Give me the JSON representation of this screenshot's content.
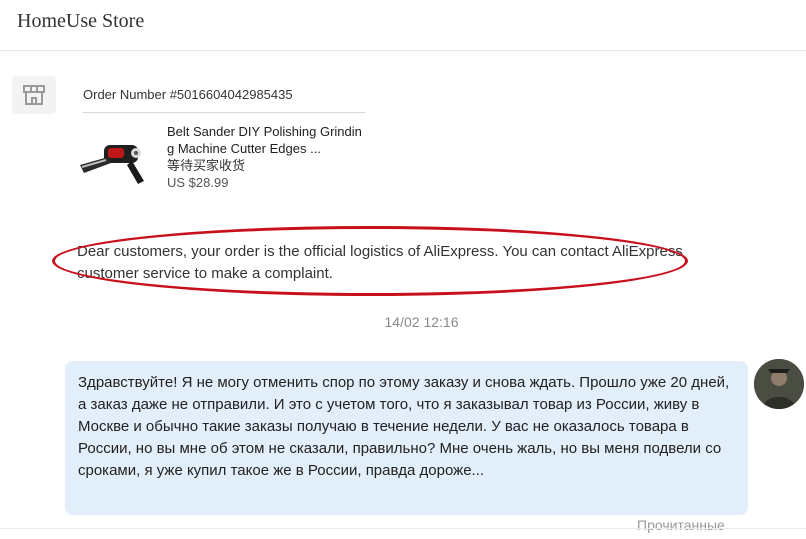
{
  "header": {
    "store_name": "HomeUse Store"
  },
  "store_avatar": {
    "icon": "store-icon"
  },
  "order": {
    "number_label": "Order Number #5016604042985435",
    "product": {
      "title": "Belt Sander DIY Polishing Grinding Machine Cutter Edges ...",
      "status": "等待买家收货",
      "price": "US $28.99",
      "thumbnail": "belt-sander-image"
    }
  },
  "messages": {
    "seller_message": "Dear customers, your order is the official logistics of AliExpress. You can contact AliExpress customer service to make a complaint.",
    "timestamp": "14/02 12:16",
    "buyer_message": "Здравствуйте! Я не могу отменить спор по этому заказу и снова ждать. Прошло уже 20 дней, а заказ даже не отправили. И это с учетом того, что я заказывал товар из России, живу в Москве и обычно такие заказы получаю в течение недели. У вас не оказалось товара в России, но вы мне об этом не сказали, правильно? Мне очень жаль, но вы меня подвели со сроками, я уже купил такое же в России, правда дороже...",
    "read_status": "Прочитанные"
  },
  "colors": {
    "highlight_ring": "#c8101c",
    "buyer_bubble": "#e3eefb",
    "timestamp": "#888888"
  }
}
